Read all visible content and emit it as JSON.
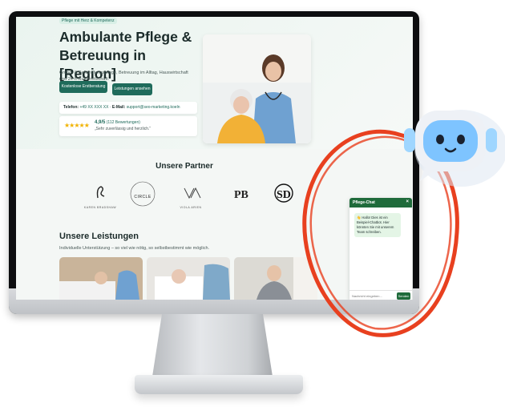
{
  "hero": {
    "tag": "Pflege mit Herz & Kompetenz",
    "title": "Ambulante Pflege & Betreuung in [Region]",
    "subtitle": "Grund- & Behandlungspflege, Betreuung im Alltag, Hauswirtschaft und 24-h-Rufbereitschaft.",
    "primary_button": "Kostenlose Erstberatung",
    "secondary_button": "Leistungen ansehen",
    "phone_label": "Telefon:",
    "phone_value": "+49 XX XXX XX",
    "email_label": "E-Mail:",
    "email_value": "support@seo-marketing.koeln",
    "rating_stars": "★★★★★",
    "rating_score": "4,9/5",
    "rating_count": "(112 Bewertungen)",
    "rating_quote": "„Sehr zuverlässig und herzlich.“"
  },
  "partners": {
    "title": "Unsere Partner",
    "logos": [
      {
        "name": "KAREN BRADSHAW",
        "icon": "swan-logo-icon"
      },
      {
        "name": "CIRCLE",
        "icon": "circle-logo-icon"
      },
      {
        "name": "VIOLA ARIEN",
        "icon": "va-monogram-icon"
      },
      {
        "name": "PB",
        "icon": "pb-monogram-icon"
      },
      {
        "name": "SD",
        "icon": "sd-monogram-icon"
      }
    ]
  },
  "services": {
    "title": "Unsere Leistungen",
    "subtitle": "Individuelle Unterstützung – so viel wie nötig, so selbstbestimmt wie möglich."
  },
  "chat": {
    "title": "Pflege-Chat",
    "close": "×",
    "message": "👋 Hallo! Dies ist ein Beispiel-Chatbot. Hier könnten Sie mit unserem Team schreiben.",
    "input_placeholder": "Nachricht eingeben…",
    "send_label": "Senden"
  },
  "colors": {
    "brand_green": "#1f6b5b",
    "chat_green": "#1f6b3b",
    "annotation_red": "#e8401f",
    "robot_blue": "#7ec4ff"
  }
}
